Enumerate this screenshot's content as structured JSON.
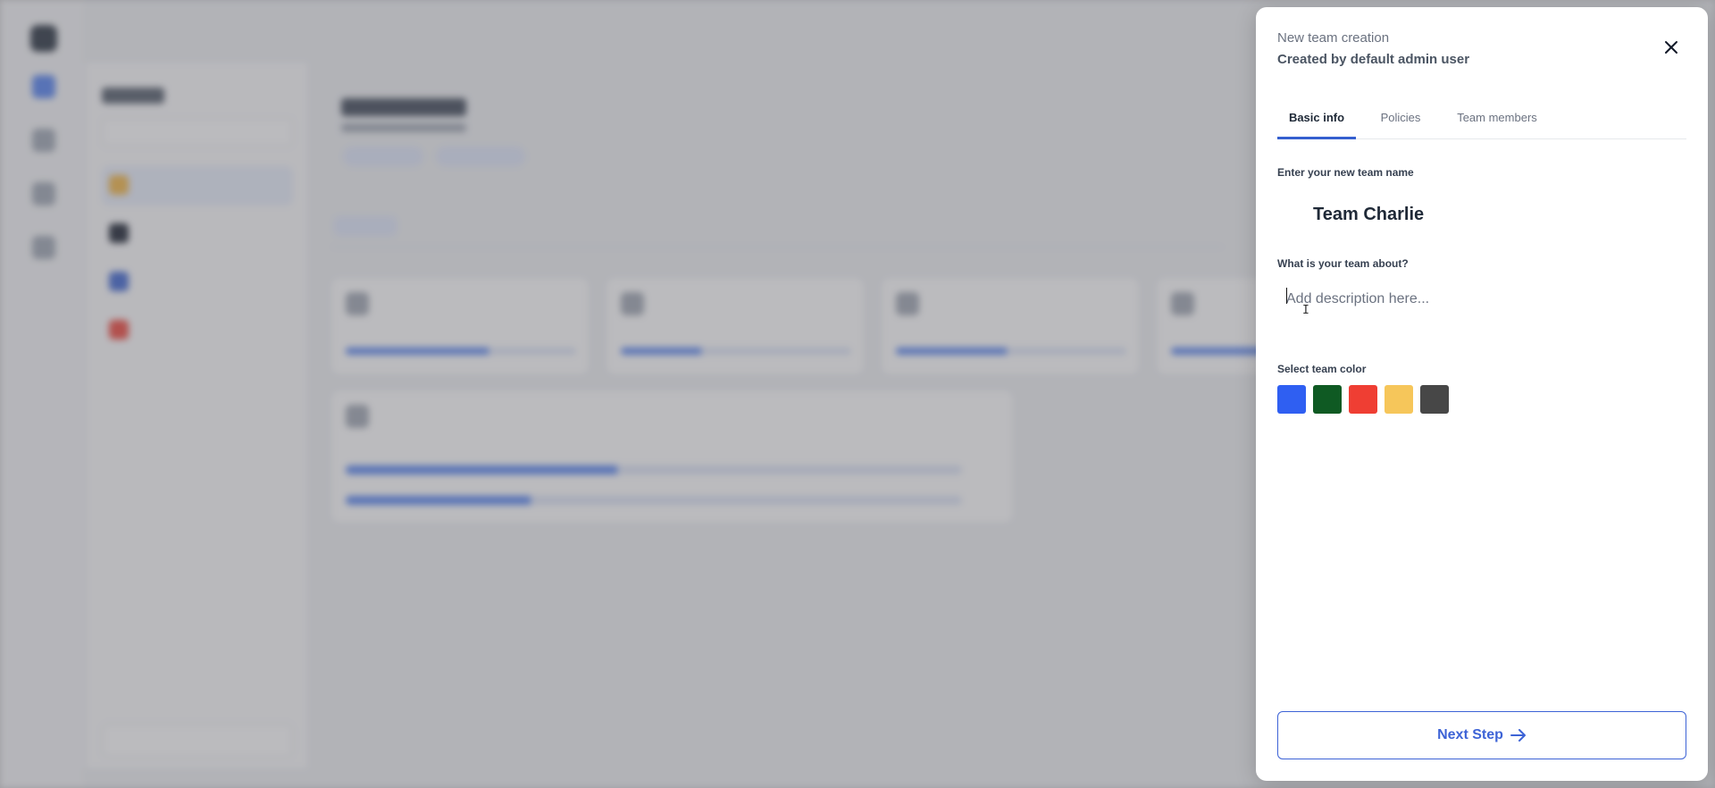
{
  "drawer": {
    "subtitle": "New team creation",
    "title": "Created by default admin user",
    "tabs": [
      {
        "label": "Basic info",
        "active": true
      },
      {
        "label": "Policies",
        "active": false
      },
      {
        "label": "Team members",
        "active": false
      }
    ],
    "name_field": {
      "label": "Enter your new team name",
      "value": "Team Charlie"
    },
    "description_field": {
      "label": "What is your team about?",
      "placeholder": "Add description here..."
    },
    "color_field": {
      "label": "Select team color",
      "colors": [
        "#2f5ff2",
        "#0f5a23",
        "#ef3e33",
        "#f6c65a",
        "#474747"
      ]
    },
    "next_button": {
      "label": "Next Step",
      "icon": "arrow-right-icon"
    },
    "close_icon": "close-icon",
    "accent_color": "#355fcf"
  }
}
